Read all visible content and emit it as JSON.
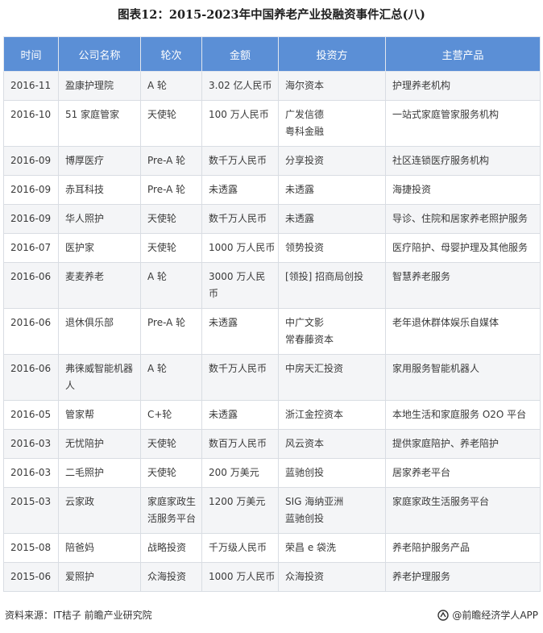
{
  "title": "图表12：2015-2023年中国养老产业投融资事件汇总(八)",
  "table": {
    "headers": [
      "时间",
      "公司名称",
      "轮次",
      "金额",
      "投资方",
      "主营产品"
    ],
    "rows": [
      [
        "2016-11",
        "盈康护理院",
        "A 轮",
        "3.02 亿人民币",
        "海尔资本",
        "护理养老机构"
      ],
      [
        "2016-10",
        "51 家庭管家",
        "天使轮",
        "100 万人民币",
        "广发信德\n粤科金融",
        "一站式家庭管家服务机构"
      ],
      [
        "2016-09",
        "博厚医疗",
        "Pre-A 轮",
        "数千万人民币",
        "分享投资",
        "社区连锁医疗服务机构"
      ],
      [
        "2016-09",
        "赤耳科技",
        "Pre-A 轮",
        "未透露",
        "未透露",
        "海捷投资"
      ],
      [
        "2016-09",
        "华人照护",
        "天使轮",
        "数千万人民币",
        "未透露",
        "导诊、住院和居家养老照护服务"
      ],
      [
        "2016-07",
        "医护家",
        "天使轮",
        "1000 万人民币",
        "领势投资",
        "医疗陪护、母婴护理及其他服务"
      ],
      [
        "2016-06",
        "麦麦养老",
        "A 轮",
        "3000 万人民\n币",
        "[领投] 招商局创投",
        "智慧养老服务"
      ],
      [
        "2016-06",
        "退休俱乐部",
        "Pre-A 轮",
        "未透露",
        "中广文影\n常春藤资本",
        "老年退休群体娱乐自媒体"
      ],
      [
        "2016-06",
        "弗徕威智能机器\n人",
        "A 轮",
        "数千万人民币",
        "中房天汇投资",
        "家用服务智能机器人"
      ],
      [
        "2016-05",
        "管家帮",
        "C+轮",
        "未透露",
        "浙江金控资本",
        "本地生活和家庭服务 O2O 平台"
      ],
      [
        "2016-03",
        "无忧陪护",
        "天使轮",
        "数百万人民币",
        "风云资本",
        "提供家庭陪护、养老陪护"
      ],
      [
        "2016-03",
        "二毛照护",
        "天使轮",
        "200 万美元",
        "蓝驰创投",
        "居家养老平台"
      ],
      [
        "2015-03",
        "云家政",
        "家庭家政生\n活服务平台",
        "1200 万美元",
        "SIG 海纳亚洲\n蓝驰创投",
        "家庭家政生活服务平台"
      ],
      [
        "2015-08",
        "陪爸妈",
        "战略投资",
        "千万级人民币",
        "荣昌 e 袋洗",
        "养老陪护服务产品"
      ],
      [
        "2015-06",
        "爱照护",
        "众海投资",
        "1000 万人民币",
        "众海投资",
        "养老护理服务"
      ]
    ]
  },
  "footer": {
    "source": "资料来源：IT桔子 前瞻产业研究院",
    "brand": "@前瞻经济学人APP",
    "brand_icon": "qianzhan-logo-icon"
  },
  "colors": {
    "header_bg": "#5b8fd6",
    "odd_row_bg": "#f4f5f7",
    "even_row_bg": "#ffffff"
  }
}
